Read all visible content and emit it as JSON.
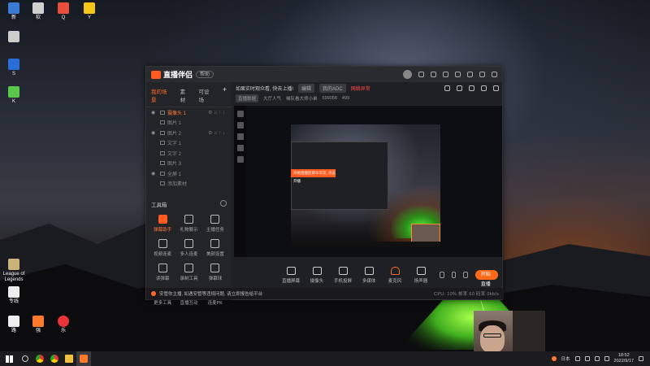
{
  "desktop": {
    "icons": [
      {
        "label": "新",
        "color": "#3a7bd5"
      },
      {
        "label": "软",
        "color": "#d0d0d0"
      },
      {
        "label": "Q",
        "color": "#e84d3d"
      },
      {
        "label": "Y",
        "color": "#f5c518"
      },
      {
        "label": "",
        "color": "#cccccc"
      },
      {
        "label": "S",
        "color": "#2a6dd9"
      },
      {
        "label": "K",
        "color": "#5ac84a"
      },
      {
        "label": "League of Legends",
        "color": "#c9b37a"
      },
      {
        "label": "专线",
        "color": "#eeeeee"
      },
      {
        "label": "路",
        "color": "#eeeeee"
      },
      {
        "label": "强",
        "color": "#ff7a2a"
      },
      {
        "label": "乐",
        "color": "#e8333a"
      }
    ]
  },
  "app": {
    "title": "直播伴侣",
    "badge": "帮助",
    "tabs": [
      {
        "label": "我的场景"
      },
      {
        "label": "素材"
      },
      {
        "label": "可设场"
      }
    ],
    "tab_add": "+",
    "scenes": [
      {
        "label": "摄像头 1",
        "active": true,
        "visible": true
      },
      {
        "label": "图片 1",
        "active": false,
        "visible": false
      },
      {
        "label": "图片 2",
        "active": false,
        "visible": true
      },
      {
        "label": "文字 1",
        "active": false,
        "visible": false
      },
      {
        "label": "文字 2",
        "active": false,
        "visible": false
      },
      {
        "label": "图片 3",
        "active": false,
        "visible": false
      },
      {
        "label": "全屏 1",
        "active": false,
        "visible": true
      },
      {
        "label": "添加素材",
        "active": false,
        "visible": false
      }
    ],
    "toolbox": {
      "title": "工具箱",
      "items": [
        {
          "label": "弹幕助手",
          "hot": true
        },
        {
          "label": "礼物展示",
          "hot": false
        },
        {
          "label": "主播任务",
          "hot": false
        },
        {
          "label": "视频连麦",
          "hot": false
        },
        {
          "label": "多人连麦",
          "hot": false
        },
        {
          "label": "美颜设置",
          "hot": false
        },
        {
          "label": "读弹幕",
          "hot": false
        },
        {
          "label": "录制工具",
          "hot": false
        },
        {
          "label": "弹幕球",
          "hot": false
        },
        {
          "label": "更多工具",
          "hot": false
        },
        {
          "label": "直播互动",
          "hot": false
        },
        {
          "label": "连麦PK",
          "hot": false
        }
      ]
    },
    "info": {
      "title": "如果实时观众看, 快去上播!",
      "tag1": "编辑",
      "tag2": "我的ADC",
      "warn": "网络异常",
      "sub_tag": "直播数据",
      "sub_text1": "大厅人气",
      "sub_text2": "梯队看大师小弟",
      "sub_num1": "599058",
      "sub_num2": "499"
    },
    "preview": {
      "toast": "开始直播后观众可见, 点击开播"
    },
    "bottom": {
      "buttons": [
        {
          "label": "直播屏幕"
        },
        {
          "label": "摄像头"
        },
        {
          "label": "手机投屏"
        },
        {
          "label": "多媒体"
        },
        {
          "label": "麦克风"
        },
        {
          "label": "扬声器"
        }
      ],
      "live_label": "开始直播"
    },
    "notice": {
      "text": "安管你主播, 如遇安管等违规问题, 请立即报告给平台",
      "stats": "CPU: 10%   帧率 60   码率 0kb/s"
    }
  },
  "taskbar": {
    "tray_lang": "日本",
    "time": "18:52",
    "date": "2022/9/17"
  },
  "colors": {
    "accent": "#ff6a1a",
    "window_bg": "#1f2023"
  }
}
